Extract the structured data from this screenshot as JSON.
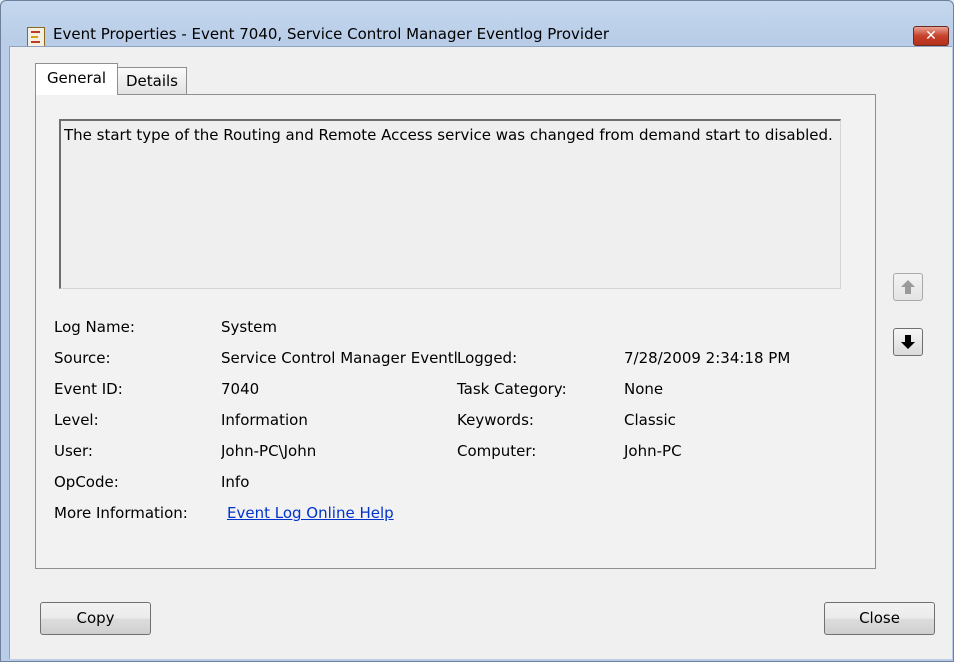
{
  "window": {
    "title": "Event Properties - Event 7040, Service Control Manager Eventlog Provider",
    "icon": "event-viewer-icon",
    "close_label": "✕"
  },
  "tabs": [
    {
      "label": "General",
      "selected": true
    },
    {
      "label": "Details",
      "selected": false
    }
  ],
  "description": "The start type of the Routing and Remote Access service was changed from demand start to disabled.",
  "fields": {
    "log_name": {
      "label": "Log Name:",
      "value": "System"
    },
    "source": {
      "label": "Source:",
      "value": "Service Control Manager Eventlog Provider"
    },
    "logged": {
      "label": "Logged:",
      "value": "7/28/2009 2:34:18 PM"
    },
    "event_id": {
      "label": "Event ID:",
      "value": "7040"
    },
    "task_category": {
      "label": "Task Category:",
      "value": "None"
    },
    "level": {
      "label": "Level:",
      "value": "Information"
    },
    "keywords": {
      "label": "Keywords:",
      "value": "Classic"
    },
    "user": {
      "label": "User:",
      "value": "John-PC\\John"
    },
    "computer": {
      "label": "Computer:",
      "value": "John-PC"
    },
    "opcode": {
      "label": "OpCode:",
      "value": "Info"
    },
    "more_info": {
      "label": "More Information:",
      "link": "Event Log Online Help"
    }
  },
  "nav": {
    "up_icon": "arrow-up-icon",
    "down_icon": "arrow-down-icon"
  },
  "buttons": {
    "copy": "Copy",
    "close": "Close"
  }
}
